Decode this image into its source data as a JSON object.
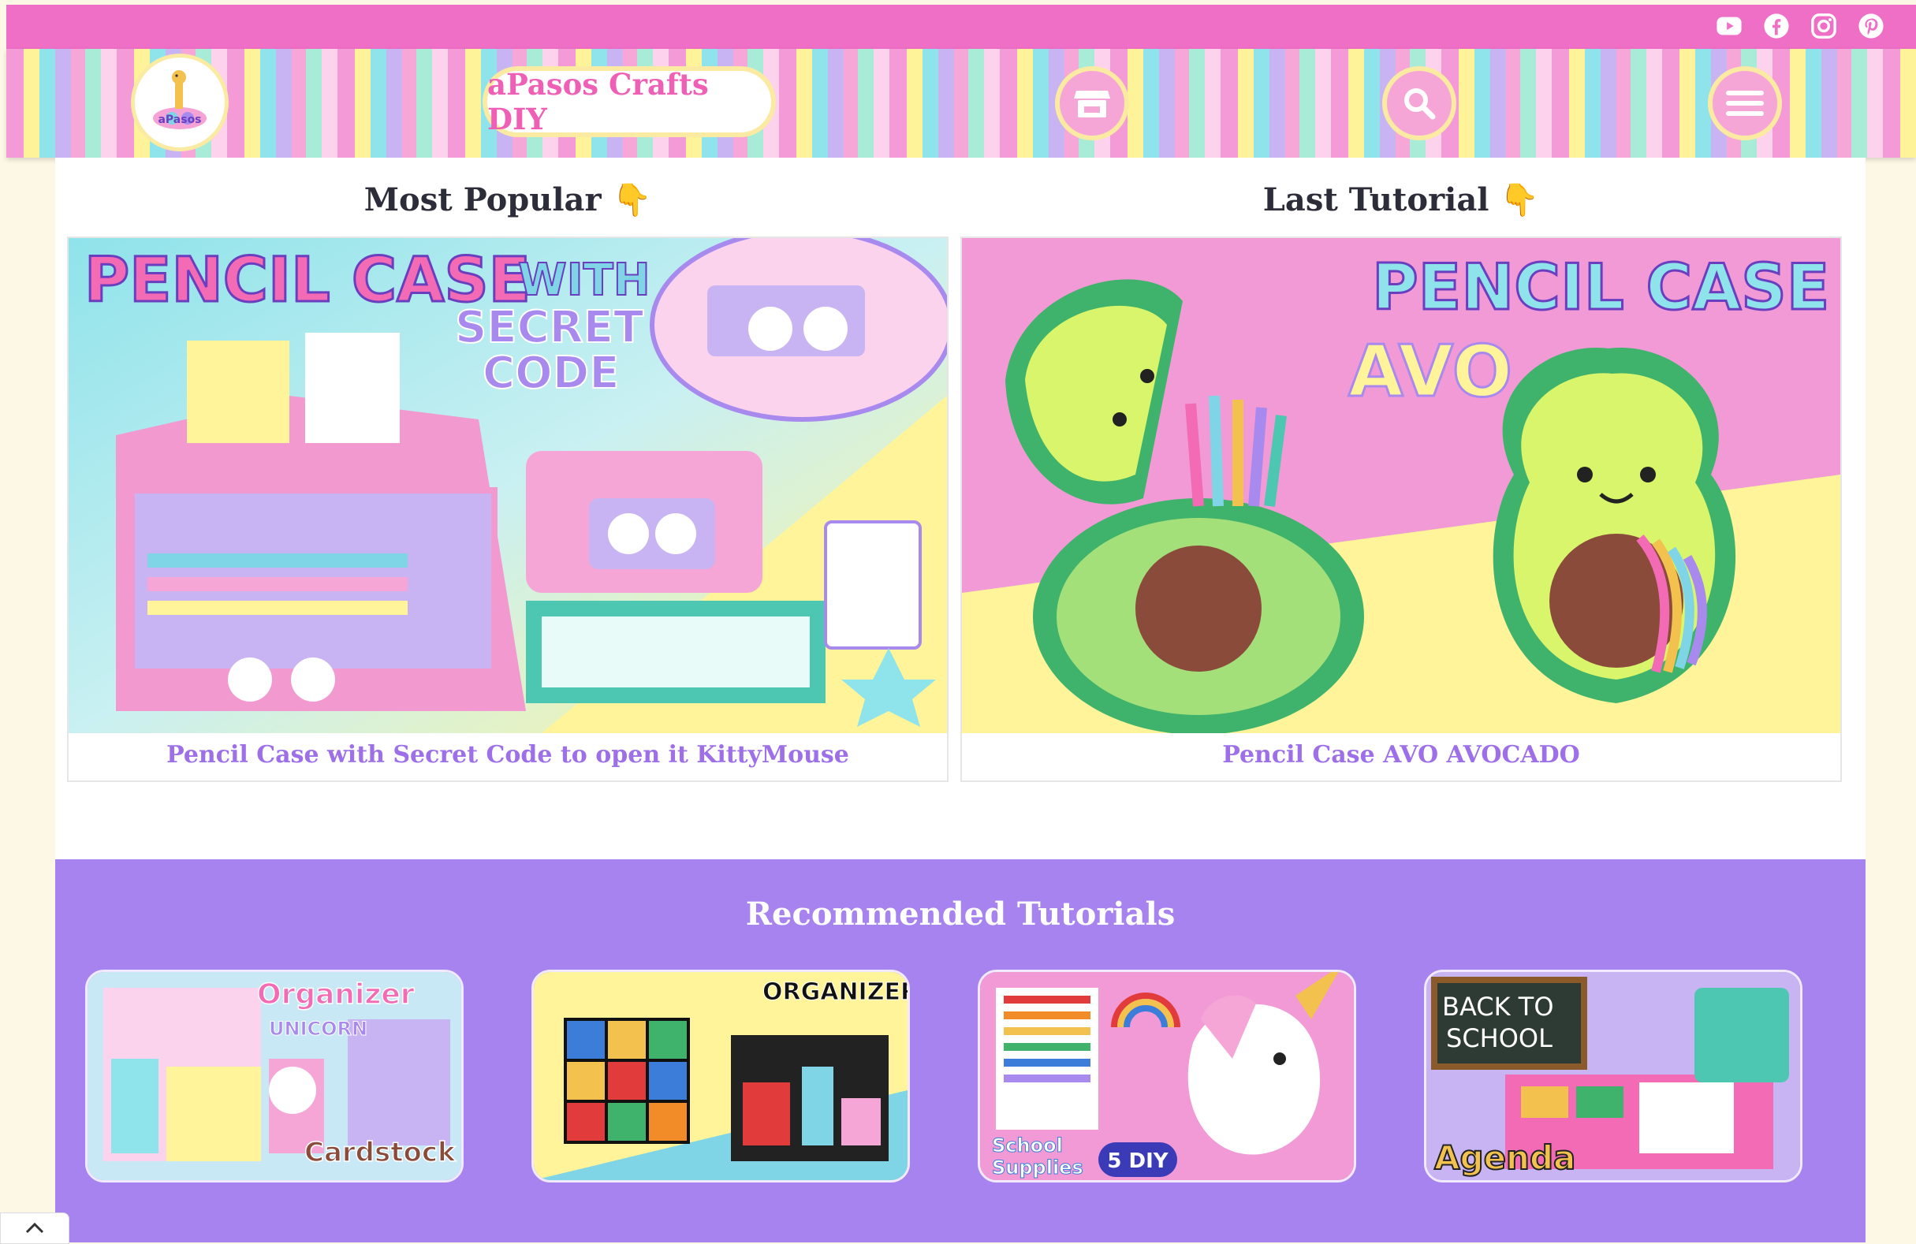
{
  "header": {
    "brand": "aPasos Crafts DIY",
    "logo_text": "aPasos",
    "social_icons": [
      "youtube-icon",
      "facebook-icon",
      "instagram-icon",
      "pinterest-icon"
    ],
    "shop_icon": "shop-icon",
    "search_icon": "search-icon",
    "menu_icon": "hamburger-menu-icon"
  },
  "featured": {
    "popular": {
      "title": "Most Popular 👇",
      "caption": "Pencil Case with Secret Code to open it KittyMouse",
      "image_text": [
        "PENCIL CASE",
        "WITH",
        "SECRET",
        "CODE"
      ]
    },
    "latest": {
      "title": "Last Tutorial 👇",
      "caption": "Pencil Case AVO AVOCADO",
      "image_text": [
        "PENCIL CASE",
        "AVO"
      ]
    }
  },
  "recommended": {
    "title": "Recommended Tutorials",
    "items": [
      {
        "image_text": [
          "Organizer",
          "UNICORN",
          "Cardstock"
        ]
      },
      {
        "image_text": [
          "ORGANIZERS"
        ]
      },
      {
        "image_text": [
          "School",
          "Supplies",
          "5 DIY"
        ]
      },
      {
        "image_text": [
          "BACK TO",
          "SCHOOL",
          "Agenda"
        ]
      }
    ]
  },
  "colors": {
    "topbar": "#ef6fc6",
    "caption": "#9d6fe9",
    "recommended_bg": "#a683ee",
    "brand_text": "#ef5fb6"
  }
}
